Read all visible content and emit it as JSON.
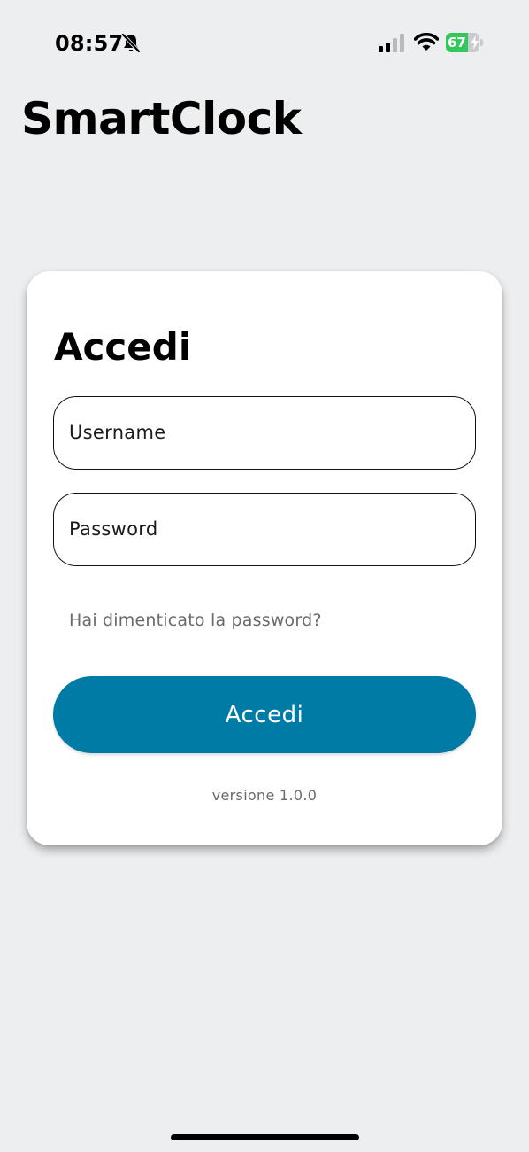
{
  "status_bar": {
    "time": "08:57",
    "silent_icon": "bell-slash-icon",
    "signal_icon": "cellular-signal-icon",
    "wifi_icon": "wifi-icon",
    "battery_level": "67",
    "battery_fraction": 0.67,
    "battery_color": "#34c759",
    "charging_icon": "bolt-icon"
  },
  "app": {
    "title": "SmartClock"
  },
  "login_card": {
    "title": "Accedi",
    "username_placeholder": "Username",
    "username_value": "",
    "password_placeholder": "Password",
    "password_value": "",
    "forgot_password_label": "Hai dimenticato la password?",
    "submit_label": "Accedi",
    "submit_color": "#007ba6",
    "version_label": "versione 1.0.0"
  }
}
